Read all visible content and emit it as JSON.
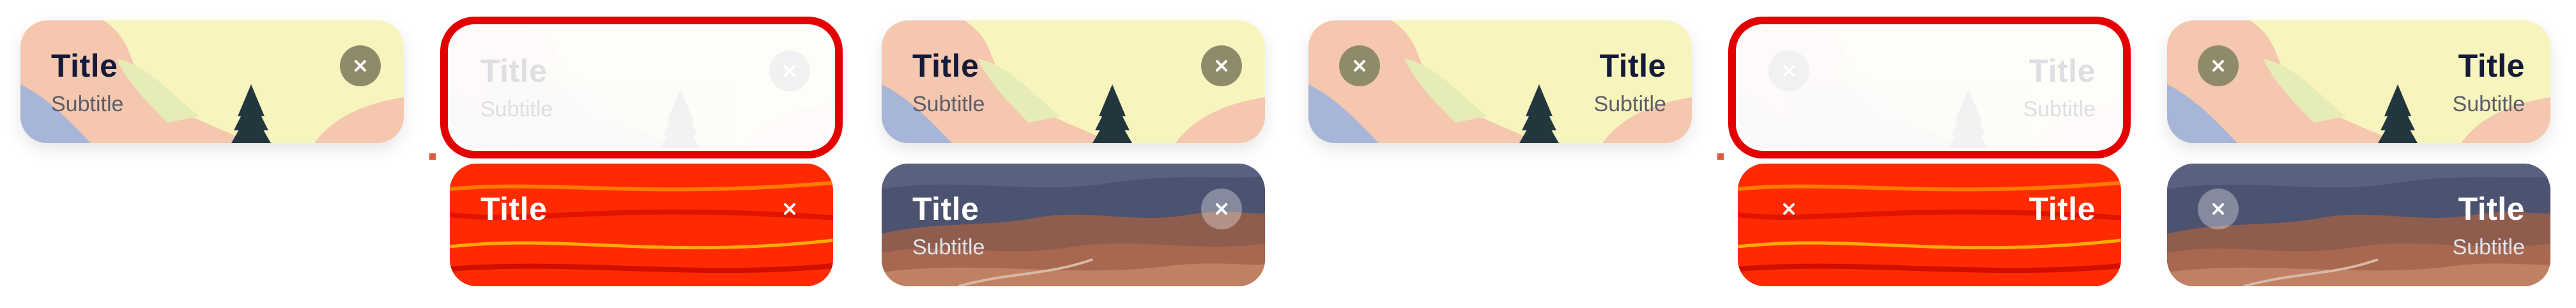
{
  "cards": [
    {
      "id": "c1",
      "title": "Title",
      "subtitle": "Subtitle"
    },
    {
      "id": "c2",
      "title": "Title",
      "subtitle": "Subtitle"
    },
    {
      "id": "c3",
      "title": "Title"
    },
    {
      "id": "c4",
      "title": "Title",
      "subtitle": "Subtitle"
    },
    {
      "id": "c5",
      "title": "Title",
      "subtitle": "Subtitle"
    },
    {
      "id": "c6",
      "title": "Title",
      "subtitle": "Subtitle"
    },
    {
      "id": "c7",
      "title": "Title",
      "subtitle": "Subtitle"
    },
    {
      "id": "c8",
      "title": "Title"
    },
    {
      "id": "c9",
      "title": "Title",
      "subtitle": "Subtitle"
    },
    {
      "id": "c10",
      "title": "Title",
      "subtitle": "Subtitle"
    }
  ],
  "icons": {
    "close": "close-icon",
    "tree": "pine-tree-icon"
  },
  "colors": {
    "selection": "#e30000",
    "cream": "#f7f5bd",
    "peach": "#f4c7ae",
    "blue": "#a7b5d8",
    "dark_sky": "#4c5370",
    "red_fill": "#ff2a00"
  }
}
